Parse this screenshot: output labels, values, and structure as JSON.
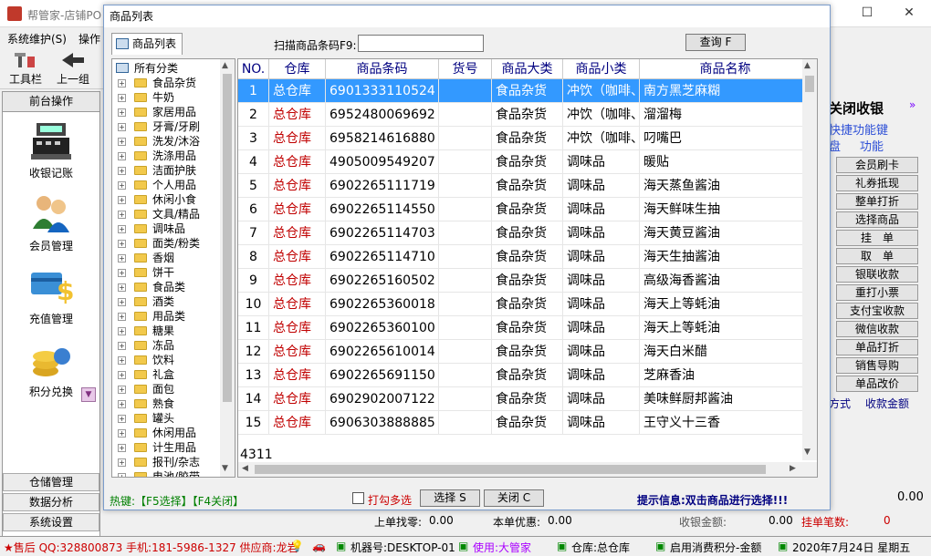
{
  "app": {
    "title": "帮管家-店铺PO",
    "menu": [
      "系统维护(S)",
      "操作"
    ],
    "toolbar": [
      {
        "label": "工具栏",
        "icon": "tools-icon"
      },
      {
        "label": "上一组",
        "icon": "back-arrow-icon"
      }
    ]
  },
  "left_panel": {
    "header": "前台操作",
    "items": [
      {
        "label": "收银记账",
        "icon": "cash-register-icon"
      },
      {
        "label": "会员管理",
        "icon": "members-icon"
      },
      {
        "label": "充值管理",
        "icon": "recharge-card-icon"
      },
      {
        "label": "积分兑换",
        "icon": "coins-icon"
      }
    ],
    "bottom": [
      "仓储管理",
      "数据分析",
      "系统设置"
    ]
  },
  "right_panel": {
    "header": "关闭收银",
    "sub1": "快捷功能键",
    "sub2a": "盘",
    "sub2b": "功能",
    "buttons": [
      "会员刷卡",
      "礼券抵现",
      "整单打折",
      "选择商品",
      "挂　单",
      "取　单",
      "银联收款",
      "重打小票",
      "支付宝收款",
      "微信收款",
      "单品打折",
      "销售导购",
      "单品改价"
    ],
    "col_a": "方式",
    "col_b": "收款金额",
    "amount": "0.00"
  },
  "behind_bottom": {
    "change_label": "上单找零:",
    "change_val": "0.00",
    "discount_label": "本单优惠:",
    "discount_val": "0.00",
    "received_label": "收银金额:",
    "received_val": "0.00",
    "pending_label": "挂单笔数:",
    "pending_val": "0"
  },
  "statusbar": {
    "sale": "★售后 QQ:328800873 手机:181-5986-1327 供应商:龙岩",
    "machine": "机器号:DESKTOP-01",
    "user": "使用:大管家",
    "warehouse": "仓库:总仓库",
    "points": "启用消费积分-金额",
    "date": "2020年7月24日  星期五"
  },
  "dialog": {
    "title": "商品列表",
    "tab": "商品列表",
    "scan_label": "扫描商品条码F9:",
    "scan_value": "",
    "query_btn": "查询 F",
    "tree_root": "所有分类",
    "tree": [
      "食品杂货",
      "牛奶",
      "家居用品",
      "牙膏/牙刷",
      "洗发/沐浴",
      "洗涤用品",
      "洁面护肤",
      "个人用品",
      "休闲小食",
      "文具/精品",
      "调味品",
      "面类/粉类",
      "香烟",
      "饼干",
      "食品类",
      "酒类",
      "用品类",
      "糖果",
      "冻品",
      "饮料",
      "礼盒",
      "面包",
      "熟食",
      "罐头",
      "休闲用品",
      "计生用品",
      "报刊/杂志",
      "电池/胶带"
    ],
    "columns": [
      "NO.",
      "仓库",
      "商品条码",
      "货号",
      "商品大类",
      "商品小类",
      "商品名称"
    ],
    "rows": [
      [
        "1",
        "总仓库",
        "6901333110524",
        "",
        "食品杂货",
        "冲饮（咖啡、",
        "南方黑芝麻糊"
      ],
      [
        "2",
        "总仓库",
        "6952480069692",
        "",
        "食品杂货",
        "冲饮（咖啡、",
        "溜溜梅"
      ],
      [
        "3",
        "总仓库",
        "6958214616880",
        "",
        "食品杂货",
        "冲饮（咖啡、",
        "叼嘴巴"
      ],
      [
        "4",
        "总仓库",
        "4905009549207",
        "",
        "食品杂货",
        "调味品",
        "暖贴"
      ],
      [
        "5",
        "总仓库",
        "6902265111719",
        "",
        "食品杂货",
        "调味品",
        "海天蒸鱼酱油"
      ],
      [
        "6",
        "总仓库",
        "6902265114550",
        "",
        "食品杂货",
        "调味品",
        "海天鲜味生抽"
      ],
      [
        "7",
        "总仓库",
        "6902265114703",
        "",
        "食品杂货",
        "调味品",
        "海天黄豆酱油"
      ],
      [
        "8",
        "总仓库",
        "6902265114710",
        "",
        "食品杂货",
        "调味品",
        "海天生抽酱油"
      ],
      [
        "9",
        "总仓库",
        "6902265160502",
        "",
        "食品杂货",
        "调味品",
        "高级海香酱油"
      ],
      [
        "10",
        "总仓库",
        "6902265360018",
        "",
        "食品杂货",
        "调味品",
        "海天上等蚝油"
      ],
      [
        "11",
        "总仓库",
        "6902265360100",
        "",
        "食品杂货",
        "调味品",
        "海天上等蚝油"
      ],
      [
        "12",
        "总仓库",
        "6902265610014",
        "",
        "食品杂货",
        "调味品",
        "海天白米醋"
      ],
      [
        "13",
        "总仓库",
        "6902265691150",
        "",
        "食品杂货",
        "调味品",
        "芝麻香油"
      ],
      [
        "14",
        "总仓库",
        "6902902007122",
        "",
        "食品杂货",
        "调味品",
        "美味鲜厨邦酱油"
      ],
      [
        "15",
        "总仓库",
        "6906303888885",
        "",
        "食品杂货",
        "调味品",
        "王守义十三香"
      ]
    ],
    "total_count": "4311",
    "hotkeys": "热键:【F5选择】【F4关闭】",
    "multi_label": "打勾多选",
    "select_btn": "选择 S",
    "close_btn": "关闭 C",
    "tip": "提示信息:双击商品进行选择!!!"
  },
  "colors": {
    "selected_row": "#3399ff",
    "warehouse_text": "#c00000",
    "header_text": "#000080"
  }
}
